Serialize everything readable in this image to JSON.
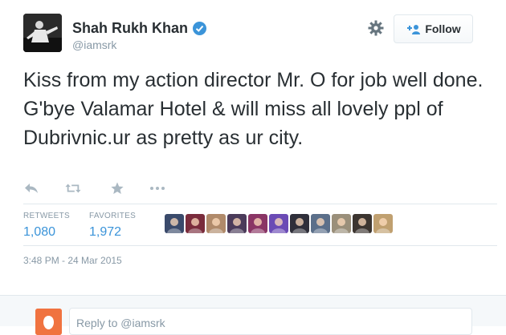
{
  "user": {
    "display_name": "Shah Rukh Khan",
    "handle": "@iamsrk",
    "verified": true
  },
  "icons": {
    "settings": "gear-icon",
    "follow": "person-add-icon",
    "verified": "verified-badge-icon",
    "reply": "reply-icon",
    "retweet": "retweet-icon",
    "favorite": "star-icon",
    "more": "more-dots-icon"
  },
  "follow_button": {
    "label": "Follow"
  },
  "tweet": {
    "text": "Kiss from my action director Mr. O for job well done. G'bye Valamar Hotel & will miss all lovely ppl of Dubrivnic.ur as pretty as ur city.",
    "timestamp": "3:48 PM - 24 Mar 2015"
  },
  "stats": {
    "retweets_label": "RETWEETS",
    "retweets_value": "1,080",
    "favorites_label": "FAVORITES",
    "favorites_value": "1,972"
  },
  "favoriters_colors": [
    "#3a4a6b",
    "#7a2c3c",
    "#b08a6a",
    "#4b3b5a",
    "#8a3565",
    "#6b4bb5",
    "#2f2f3a",
    "#5b6f8a",
    "#9a8f7a",
    "#3c3530",
    "#c0a070"
  ],
  "reply": {
    "placeholder": "Reply to @iamsrk"
  },
  "colors": {
    "accent": "#3b94d9",
    "muted": "#8899a6",
    "text": "#292f33",
    "my_avatar": "#f07340"
  }
}
